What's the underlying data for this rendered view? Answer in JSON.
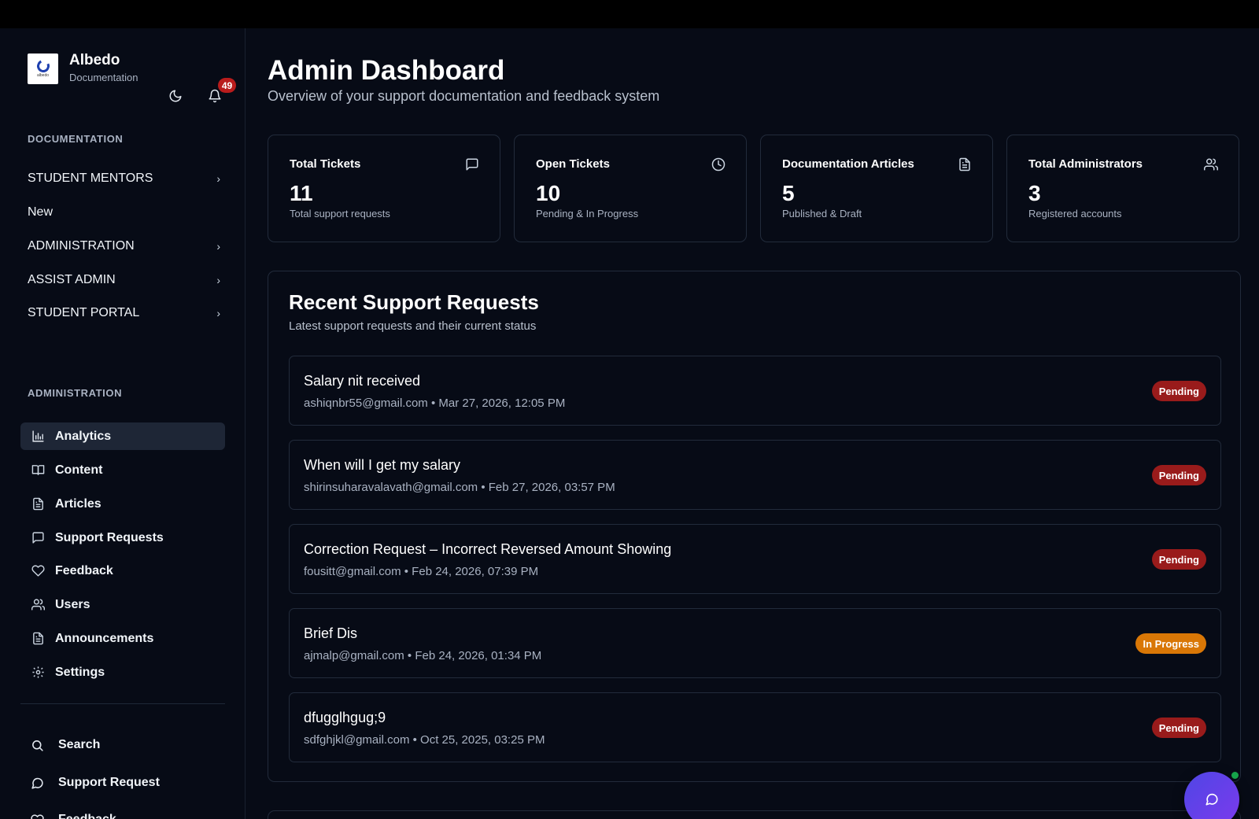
{
  "brand": {
    "name": "Albedo",
    "subtitle": "Documentation",
    "logo_text": "albedo"
  },
  "notifications": {
    "count": "49"
  },
  "sidebar": {
    "documentation_label": "DOCUMENTATION",
    "doc_items": [
      {
        "label": "STUDENT MENTORS",
        "expandable": true
      },
      {
        "label": "New",
        "expandable": false
      },
      {
        "label": "ADMINISTRATION",
        "expandable": true
      },
      {
        "label": "ASSIST ADMIN",
        "expandable": true
      },
      {
        "label": "STUDENT PORTAL",
        "expandable": true
      }
    ],
    "administration_label": "ADMINISTRATION",
    "admin_items": [
      {
        "label": "Analytics",
        "icon": "bar-chart-icon",
        "active": true
      },
      {
        "label": "Content",
        "icon": "book-icon"
      },
      {
        "label": "Articles",
        "icon": "document-icon"
      },
      {
        "label": "Support Requests",
        "icon": "message-square-icon"
      },
      {
        "label": "Feedback",
        "icon": "heart-icon"
      },
      {
        "label": "Users",
        "icon": "users-icon"
      },
      {
        "label": "Announcements",
        "icon": "document-icon"
      },
      {
        "label": "Settings",
        "icon": "gear-icon"
      }
    ],
    "footer_items": [
      {
        "label": "Search",
        "icon": "search-icon"
      },
      {
        "label": "Support Request",
        "icon": "message-circle-icon"
      },
      {
        "label": "Feedback",
        "icon": "heart-icon"
      }
    ]
  },
  "header": {
    "title": "Admin Dashboard",
    "subtitle": "Overview of your support documentation and feedback system"
  },
  "stats": [
    {
      "title": "Total Tickets",
      "value": "11",
      "desc": "Total support requests",
      "icon": "message-square-icon"
    },
    {
      "title": "Open Tickets",
      "value": "10",
      "desc": "Pending & In Progress",
      "icon": "clock-icon"
    },
    {
      "title": "Documentation Articles",
      "value": "5",
      "desc": "Published & Draft",
      "icon": "document-icon"
    },
    {
      "title": "Total Administrators",
      "value": "3",
      "desc": "Registered accounts",
      "icon": "users-icon"
    }
  ],
  "requests": {
    "title": "Recent Support Requests",
    "subtitle": "Latest support requests and their current status",
    "items": [
      {
        "title": "Salary nit received",
        "meta": "ashiqnbr55@gmail.com • Mar 27, 2026, 12:05 PM",
        "status": "Pending"
      },
      {
        "title": "When will I get my salary",
        "meta": "shirinsuharavalavath@gmail.com • Feb 27, 2026, 03:57 PM",
        "status": "Pending"
      },
      {
        "title": "Correction Request – Incorrect Reversed Amount Showing",
        "meta": "fousitt@gmail.com • Feb 24, 2026, 07:39 PM",
        "status": "Pending"
      },
      {
        "title": "Brief Dis",
        "meta": "ajmalp@gmail.com • Feb 24, 2026, 01:34 PM",
        "status": "In Progress"
      },
      {
        "title": "dfugglhgug;9",
        "meta": "sdfghjkl@gmail.com • Oct 25, 2025, 03:25 PM",
        "status": "Pending"
      }
    ]
  },
  "colors": {
    "pending": "#991b1b",
    "in_progress": "#d97706",
    "chat_fab": "#5b45e6",
    "online": "#16a34a"
  }
}
